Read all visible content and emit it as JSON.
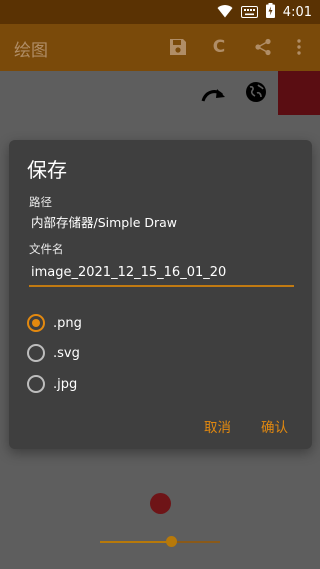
{
  "status_bar": {
    "time": "4:01"
  },
  "toolbar": {
    "title": "绘图",
    "save_icon": "save-icon",
    "clear_label": "C",
    "share_icon": "share-icon",
    "more_icon": "more-vert-icon"
  },
  "canvas": {
    "swatch_color": "#5a0d12",
    "brush_color": "#6e1417",
    "brush_size_fraction": 0.6
  },
  "dialog": {
    "title": "保存",
    "path_label": "路径",
    "path_value": "内部存储器/Simple Draw",
    "filename_label": "文件名",
    "filename_value": "image_2021_12_15_16_01_20",
    "formats": [
      {
        "label": ".png",
        "selected": true
      },
      {
        "label": ".svg",
        "selected": false
      },
      {
        "label": ".jpg",
        "selected": false
      }
    ],
    "cancel_label": "取消",
    "confirm_label": "确认"
  },
  "colors": {
    "accent": "#e3890f",
    "toolbar": "#7a4a0a",
    "status_bar": "#5a3203",
    "dialog_bg": "#3f3f3f"
  }
}
